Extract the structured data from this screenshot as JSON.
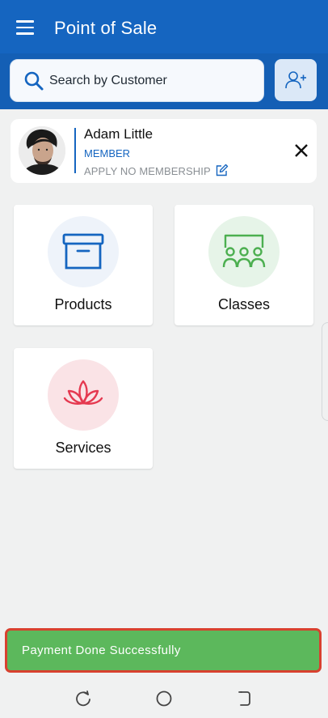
{
  "header": {
    "title": "Point of Sale",
    "menu_icon": "hamburger-menu-icon"
  },
  "search": {
    "placeholder": "Search by Customer",
    "icon": "search-icon"
  },
  "add_customer": {
    "icon": "add-user-icon"
  },
  "customer": {
    "name": "Adam Little",
    "tier": "MEMBER",
    "membership_action": "APPLY NO MEMBERSHIP",
    "edit_icon": "edit-icon",
    "close_icon": "close-icon"
  },
  "categories": [
    {
      "label": "Products",
      "icon": "archive-box-icon",
      "color": "#1565c0",
      "bg": "#eef3fa"
    },
    {
      "label": "Classes",
      "icon": "group-class-icon",
      "color": "#4caf50",
      "bg": "#e6f4e8"
    },
    {
      "label": "Services",
      "icon": "lotus-icon",
      "color": "#e53950",
      "bg": "#fae3e6"
    }
  ],
  "toast": {
    "message": "Payment Done Successfully"
  },
  "colors": {
    "primary": "#1565c0",
    "success": "#5cb85c",
    "highlight_border": "#d8412f"
  }
}
